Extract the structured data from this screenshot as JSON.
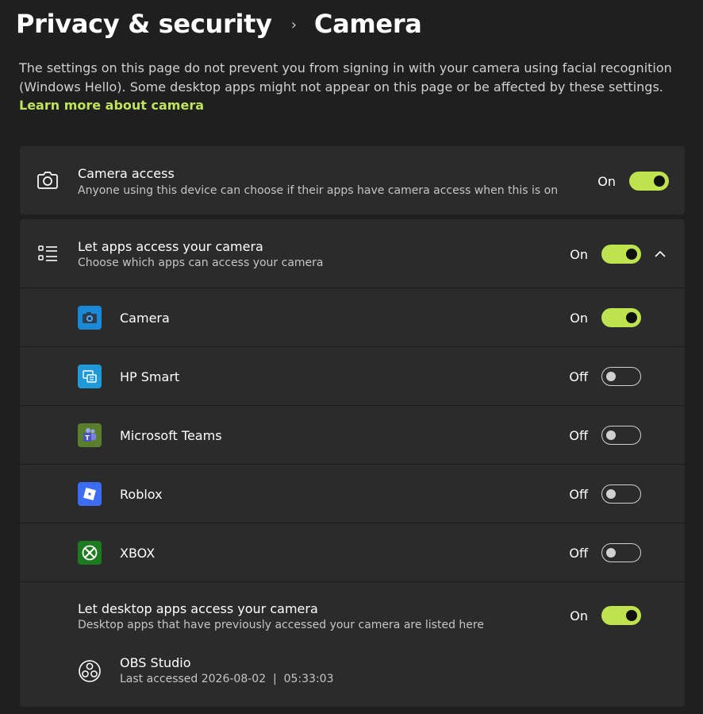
{
  "breadcrumb": {
    "parent": "Privacy & security",
    "separator": "›",
    "current": "Camera"
  },
  "description": {
    "text": "The settings on this page do not prevent you from signing in with your camera using facial recognition (Windows Hello). Some desktop apps might not appear on this page or be affected by these settings.",
    "link": "Learn more about camera"
  },
  "camera_access": {
    "icon": "camera-icon",
    "title": "Camera access",
    "subtitle": "Anyone using this device can choose if their apps have camera access when this is on",
    "state": "On",
    "enabled": true
  },
  "let_apps": {
    "icon": "list-icon",
    "title": "Let apps access your camera",
    "subtitle": "Choose which apps can access your camera",
    "state": "On",
    "enabled": true,
    "expanded": true
  },
  "apps": [
    {
      "name": "Camera",
      "state": "On",
      "enabled": true,
      "icon": "camera-app-icon",
      "color": "#1a8ad8"
    },
    {
      "name": "HP Smart",
      "state": "Off",
      "enabled": false,
      "icon": "hp-smart-icon",
      "color": "#1f9ad6"
    },
    {
      "name": "Microsoft Teams",
      "state": "Off",
      "enabled": false,
      "icon": "teams-icon",
      "color": "#5a7f2c"
    },
    {
      "name": "Roblox",
      "state": "Off",
      "enabled": false,
      "icon": "roblox-icon",
      "color": "#3b6cf2"
    },
    {
      "name": "XBOX",
      "state": "Off",
      "enabled": false,
      "icon": "xbox-icon",
      "color": "#1e7a1e"
    }
  ],
  "desktop_apps": {
    "title": "Let desktop apps access your camera",
    "subtitle": "Desktop apps that have previously accessed your camera are listed here",
    "state": "On",
    "enabled": true,
    "entries": [
      {
        "name": "OBS Studio",
        "last_accessed": "Last accessed 2026-08-02  |  05:33:03",
        "icon": "obs-icon"
      }
    ]
  },
  "colors": {
    "accent": "#bfe34e",
    "link": "#bfe35a",
    "background": "#1f1f1f",
    "card": "#2b2b2b"
  }
}
